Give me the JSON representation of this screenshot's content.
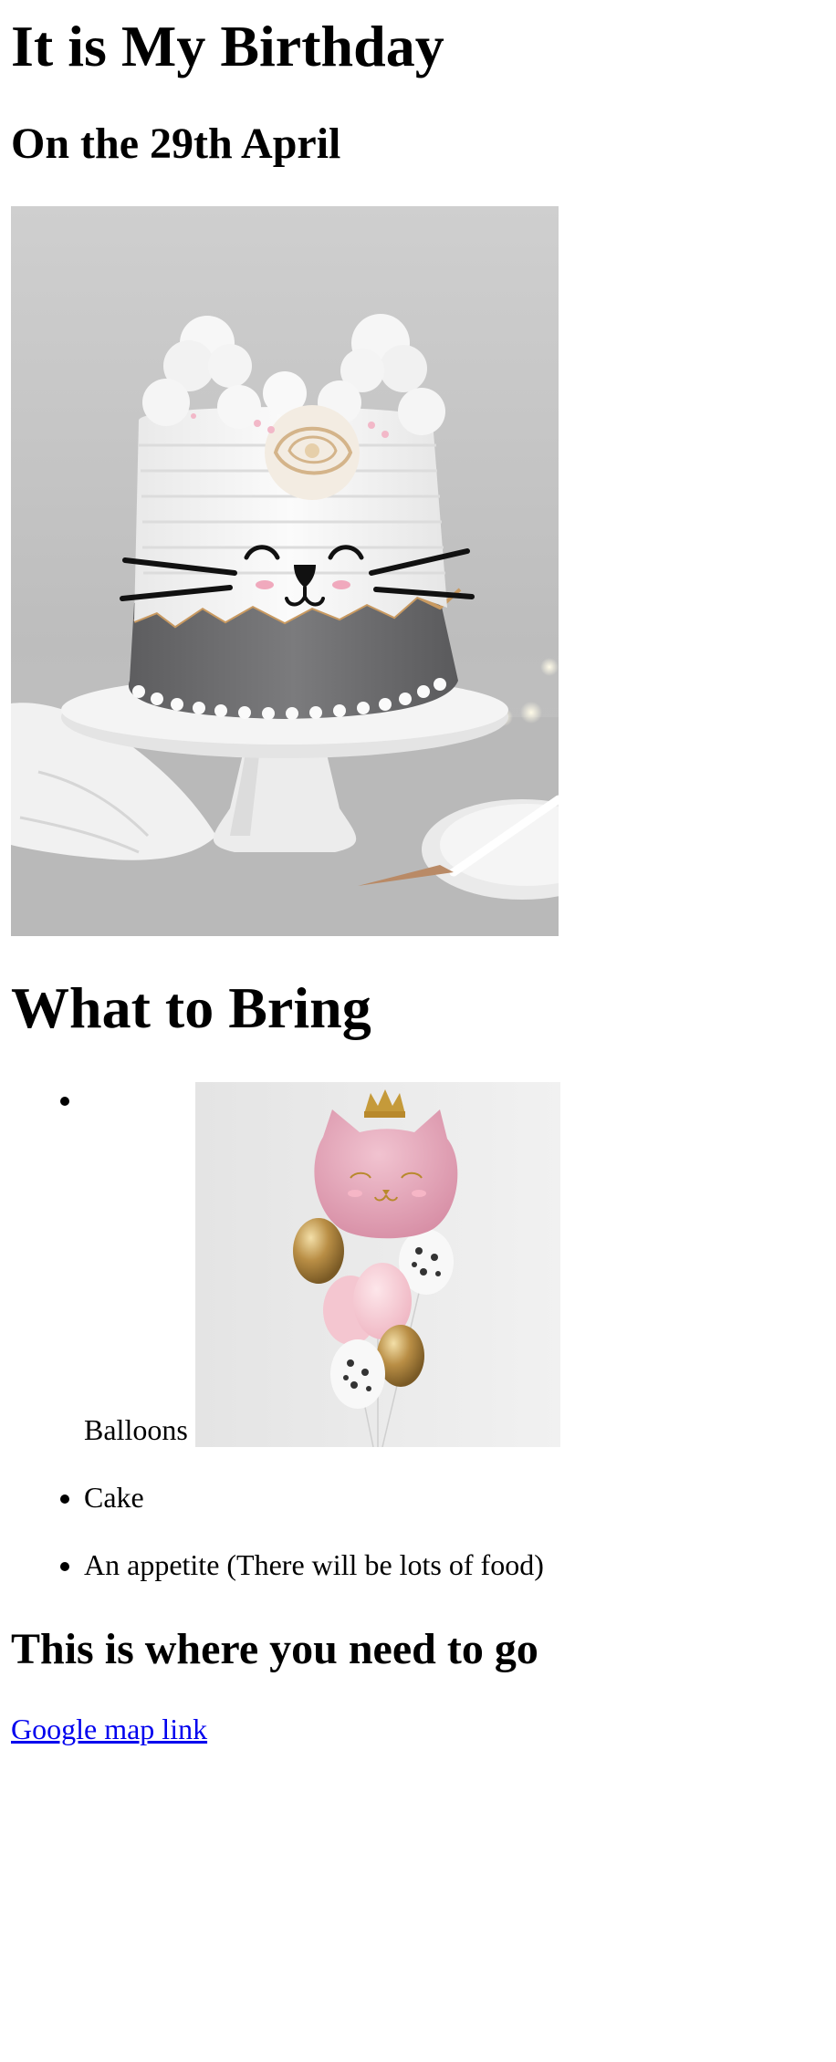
{
  "header": {
    "title": "It is My Birthday",
    "date": "On the 29th April"
  },
  "cake_image": {
    "alt": "",
    "icon": "cat-cake-image"
  },
  "bring": {
    "heading": "What to Bring",
    "items": [
      {
        "label": "Balloons"
      },
      {
        "label": "Cake"
      },
      {
        "label": "An appetite (There will be lots of food)"
      }
    ],
    "balloon_image": {
      "alt": "",
      "icon": "cat-balloons-image"
    }
  },
  "location": {
    "heading": "This is where you need to go",
    "link_text": "Google map link",
    "link_color": "#0000ee"
  }
}
